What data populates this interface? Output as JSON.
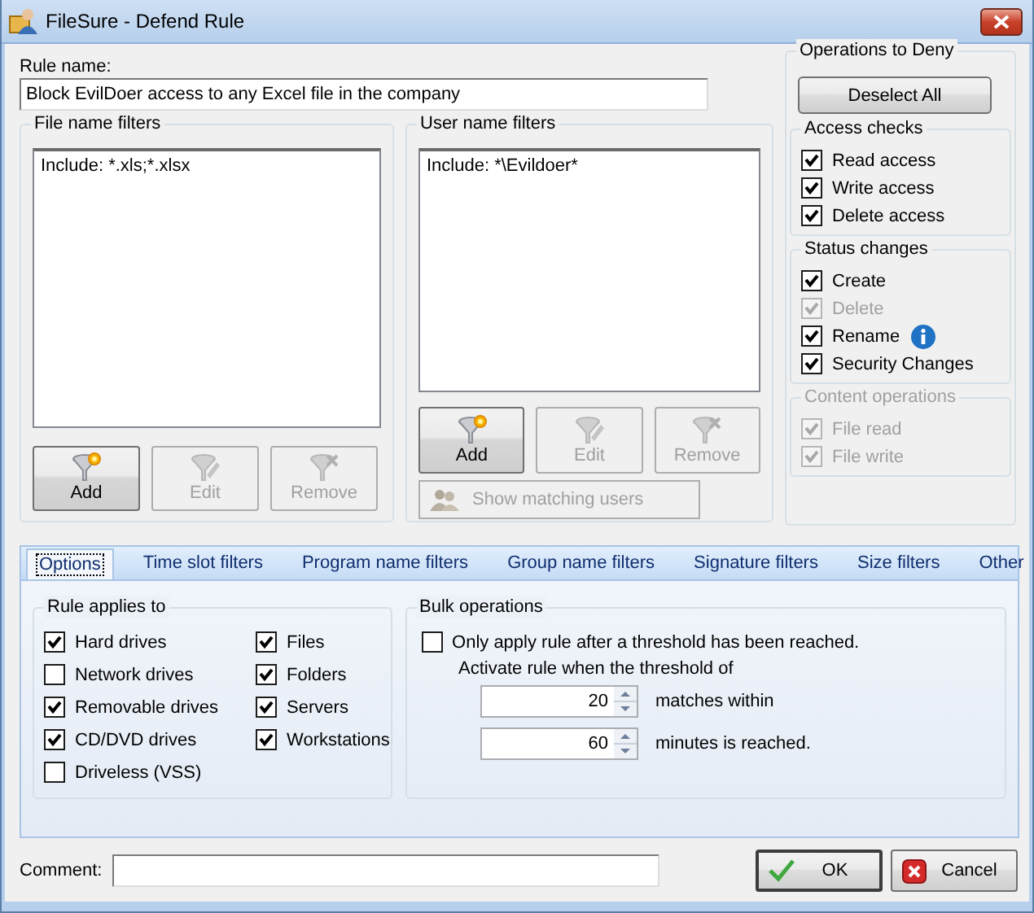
{
  "window": {
    "title": "FileSure - Defend Rule"
  },
  "rule_name": {
    "label": "Rule name:",
    "value": "Block EvilDoer access to any Excel file in the company"
  },
  "file_name_filters": {
    "title": "File name filters",
    "items": [
      "Include: *.xls;*.xlsx"
    ],
    "buttons": [
      {
        "kind": "add",
        "label": "Add",
        "disabled": false
      },
      {
        "kind": "edit",
        "label": "Edit",
        "disabled": true
      },
      {
        "kind": "remove",
        "label": "Remove",
        "disabled": true
      }
    ]
  },
  "user_name_filters": {
    "title": "User name filters",
    "items": [
      "Include: *\\Evildoer*"
    ],
    "buttons": [
      {
        "kind": "add",
        "label": "Add",
        "disabled": false
      },
      {
        "kind": "edit",
        "label": "Edit",
        "disabled": true
      },
      {
        "kind": "remove",
        "label": "Remove",
        "disabled": true
      }
    ],
    "show_matching": {
      "label": "Show matching users",
      "disabled": true
    }
  },
  "operations_to_deny": {
    "title": "Operations to Deny",
    "deselect_all": "Deselect All",
    "groups": [
      {
        "title": "Access checks",
        "disabled": false,
        "items": [
          {
            "label": "Read access",
            "checked": true,
            "disabled": false,
            "info": false
          },
          {
            "label": "Write access",
            "checked": true,
            "disabled": false,
            "info": false
          },
          {
            "label": "Delete access",
            "checked": true,
            "disabled": false,
            "info": false
          }
        ]
      },
      {
        "title": "Status changes",
        "disabled": false,
        "items": [
          {
            "label": "Create",
            "checked": true,
            "disabled": false,
            "info": false
          },
          {
            "label": "Delete",
            "checked": true,
            "disabled": true,
            "info": false
          },
          {
            "label": "Rename",
            "checked": true,
            "disabled": false,
            "info": true
          },
          {
            "label": "Security Changes",
            "checked": true,
            "disabled": false,
            "info": false
          }
        ]
      },
      {
        "title": "Content operations",
        "disabled": true,
        "items": [
          {
            "label": "File read",
            "checked": true,
            "disabled": true,
            "info": false
          },
          {
            "label": "File write",
            "checked": true,
            "disabled": true,
            "info": false
          }
        ]
      }
    ]
  },
  "tabs": [
    {
      "label": "Options",
      "selected": true
    },
    {
      "label": "Time slot filters",
      "selected": false
    },
    {
      "label": "Program name filters",
      "selected": false
    },
    {
      "label": "Group name filters",
      "selected": false
    },
    {
      "label": "Signature filters",
      "selected": false
    },
    {
      "label": "Size filters",
      "selected": false
    },
    {
      "label": "Other",
      "selected": false
    }
  ],
  "rule_applies_to": {
    "title": "Rule applies to",
    "columns": [
      [
        {
          "label": "Hard drives",
          "checked": true
        },
        {
          "label": "Network drives",
          "checked": false
        },
        {
          "label": "Removable drives",
          "checked": true
        },
        {
          "label": "CD/DVD drives",
          "checked": true
        },
        {
          "label": "Driveless (VSS)",
          "checked": false
        }
      ],
      [
        {
          "label": "Files",
          "checked": true
        },
        {
          "label": "Folders",
          "checked": true
        },
        {
          "label": "Servers",
          "checked": true
        },
        {
          "label": "Workstations",
          "checked": true
        }
      ]
    ]
  },
  "bulk_operations": {
    "title": "Bulk operations",
    "threshold": {
      "label": "Only apply rule after a threshold has been reached.",
      "checked": false
    },
    "activate_label": "Activate rule when the threshold of",
    "spinners": [
      {
        "value": "20",
        "label": "matches within"
      },
      {
        "value": "60",
        "label": "minutes is reached."
      }
    ]
  },
  "comment": {
    "label": "Comment:"
  },
  "buttons": [
    {
      "kind": "ok",
      "label": "OK"
    },
    {
      "kind": "cancel",
      "label": "Cancel"
    }
  ]
}
